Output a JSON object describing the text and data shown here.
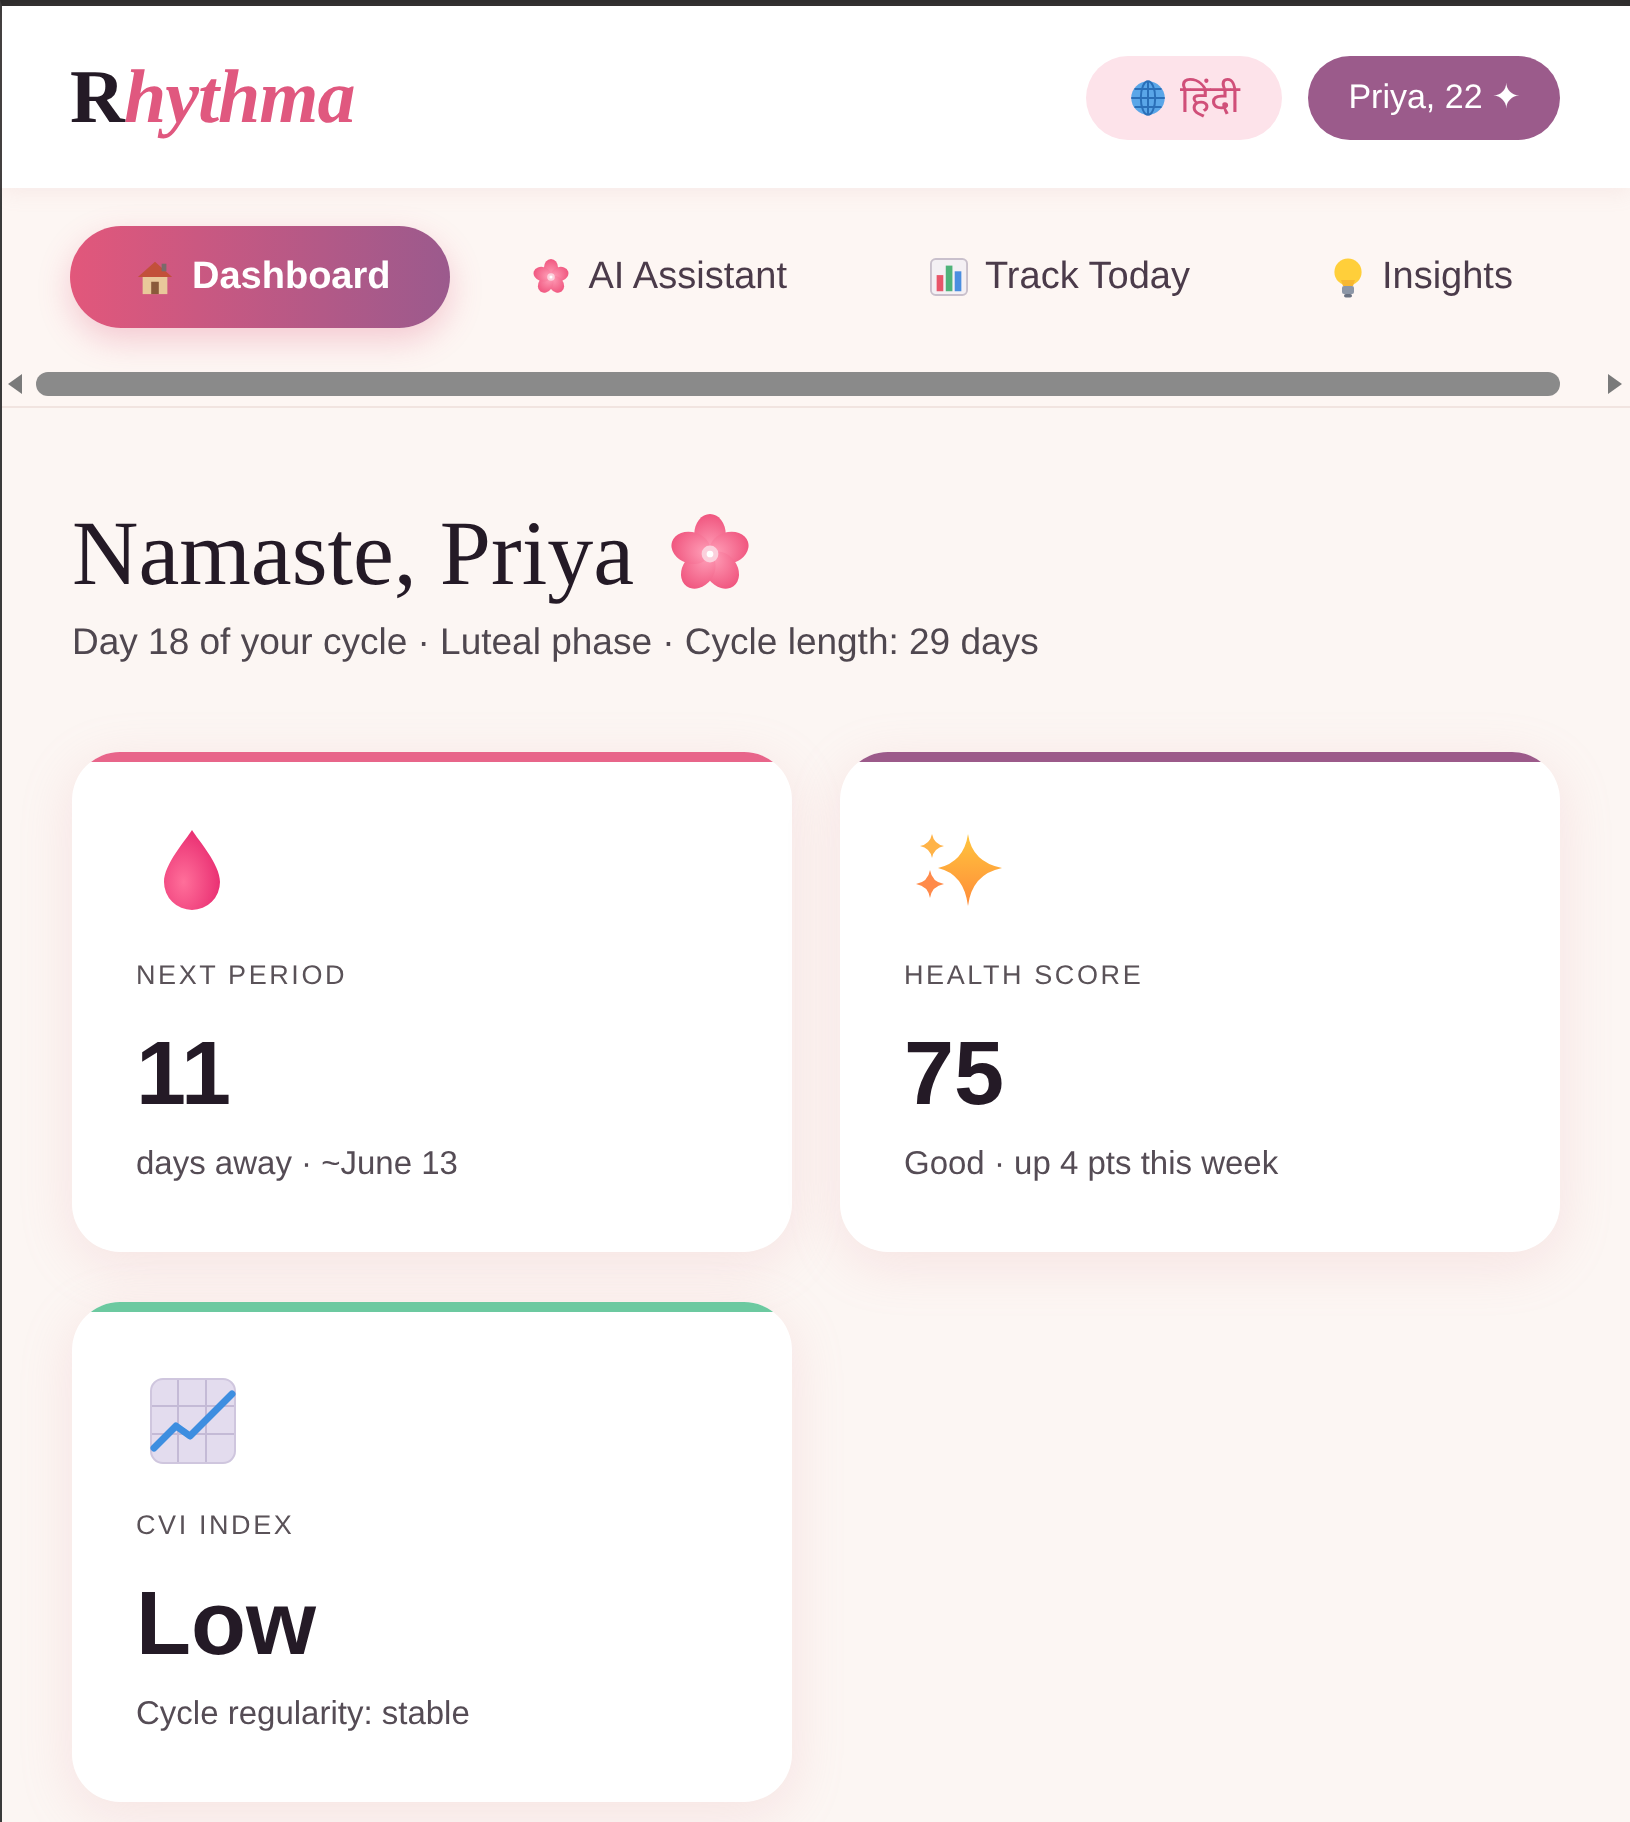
{
  "header": {
    "logo": "Rhythma",
    "language_button": "हिंदी",
    "profile_button": "Priya, 22 ✦"
  },
  "nav": {
    "tabs": [
      {
        "label": "Dashboard",
        "selected": true
      },
      {
        "label": "AI Assistant",
        "selected": false
      },
      {
        "label": "Track Today",
        "selected": false
      },
      {
        "label": "Insights",
        "selected": false
      }
    ]
  },
  "greeting": {
    "title": "Namaste, Priya",
    "subtitle": "Day 18 of your cycle · Luteal phase · Cycle length: 29 days"
  },
  "cards": [
    {
      "label": "NEXT PERIOD",
      "value": "11",
      "detail": "days away · ~June 13",
      "color": "#e8658a"
    },
    {
      "label": "HEALTH SCORE",
      "value": "75",
      "detail": "Good · up 4 pts this week",
      "color": "#9c5a8a"
    },
    {
      "label": "CVI INDEX",
      "value": "Low",
      "detail": "Cycle regularity: stable",
      "color": "#6cc9a0"
    }
  ]
}
